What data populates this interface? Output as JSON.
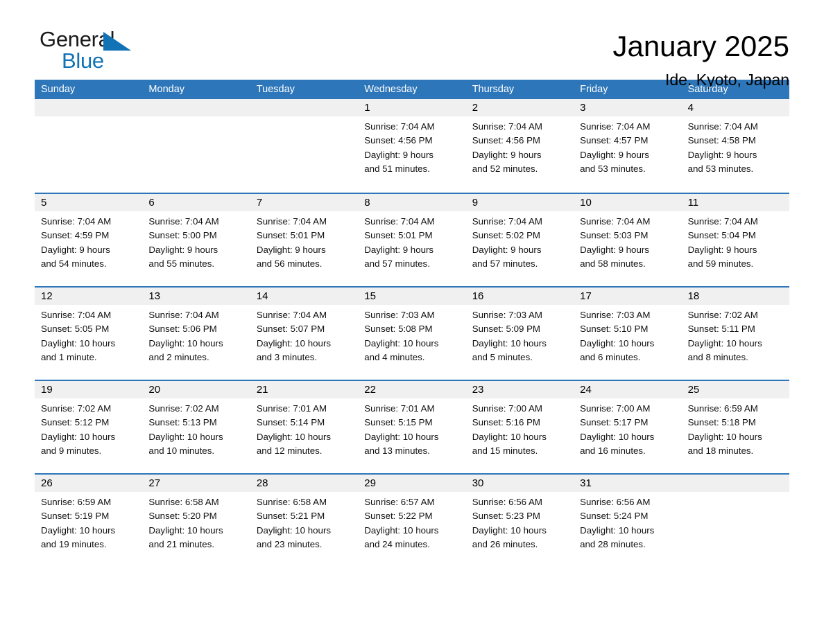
{
  "logo": {
    "line1": "General",
    "line2": "Blue",
    "triangle_color": "#1272b6"
  },
  "header": {
    "month_title": "January 2025",
    "location": "Ide, Kyoto, Japan",
    "header_bg_color": "#2d76b9",
    "row_rule_color": "#2d76b9",
    "day_number_bg": "#f0f0f0"
  },
  "weekdays": [
    "Sunday",
    "Monday",
    "Tuesday",
    "Wednesday",
    "Thursday",
    "Friday",
    "Saturday"
  ],
  "weeks": [
    [
      {
        "day": "",
        "sunrise": "",
        "sunset": "",
        "daylight1": "",
        "daylight2": ""
      },
      {
        "day": "",
        "sunrise": "",
        "sunset": "",
        "daylight1": "",
        "daylight2": ""
      },
      {
        "day": "",
        "sunrise": "",
        "sunset": "",
        "daylight1": "",
        "daylight2": ""
      },
      {
        "day": "1",
        "sunrise": "Sunrise: 7:04 AM",
        "sunset": "Sunset: 4:56 PM",
        "daylight1": "Daylight: 9 hours",
        "daylight2": "and 51 minutes."
      },
      {
        "day": "2",
        "sunrise": "Sunrise: 7:04 AM",
        "sunset": "Sunset: 4:56 PM",
        "daylight1": "Daylight: 9 hours",
        "daylight2": "and 52 minutes."
      },
      {
        "day": "3",
        "sunrise": "Sunrise: 7:04 AM",
        "sunset": "Sunset: 4:57 PM",
        "daylight1": "Daylight: 9 hours",
        "daylight2": "and 53 minutes."
      },
      {
        "day": "4",
        "sunrise": "Sunrise: 7:04 AM",
        "sunset": "Sunset: 4:58 PM",
        "daylight1": "Daylight: 9 hours",
        "daylight2": "and 53 minutes."
      }
    ],
    [
      {
        "day": "5",
        "sunrise": "Sunrise: 7:04 AM",
        "sunset": "Sunset: 4:59 PM",
        "daylight1": "Daylight: 9 hours",
        "daylight2": "and 54 minutes."
      },
      {
        "day": "6",
        "sunrise": "Sunrise: 7:04 AM",
        "sunset": "Sunset: 5:00 PM",
        "daylight1": "Daylight: 9 hours",
        "daylight2": "and 55 minutes."
      },
      {
        "day": "7",
        "sunrise": "Sunrise: 7:04 AM",
        "sunset": "Sunset: 5:01 PM",
        "daylight1": "Daylight: 9 hours",
        "daylight2": "and 56 minutes."
      },
      {
        "day": "8",
        "sunrise": "Sunrise: 7:04 AM",
        "sunset": "Sunset: 5:01 PM",
        "daylight1": "Daylight: 9 hours",
        "daylight2": "and 57 minutes."
      },
      {
        "day": "9",
        "sunrise": "Sunrise: 7:04 AM",
        "sunset": "Sunset: 5:02 PM",
        "daylight1": "Daylight: 9 hours",
        "daylight2": "and 57 minutes."
      },
      {
        "day": "10",
        "sunrise": "Sunrise: 7:04 AM",
        "sunset": "Sunset: 5:03 PM",
        "daylight1": "Daylight: 9 hours",
        "daylight2": "and 58 minutes."
      },
      {
        "day": "11",
        "sunrise": "Sunrise: 7:04 AM",
        "sunset": "Sunset: 5:04 PM",
        "daylight1": "Daylight: 9 hours",
        "daylight2": "and 59 minutes."
      }
    ],
    [
      {
        "day": "12",
        "sunrise": "Sunrise: 7:04 AM",
        "sunset": "Sunset: 5:05 PM",
        "daylight1": "Daylight: 10 hours",
        "daylight2": "and 1 minute."
      },
      {
        "day": "13",
        "sunrise": "Sunrise: 7:04 AM",
        "sunset": "Sunset: 5:06 PM",
        "daylight1": "Daylight: 10 hours",
        "daylight2": "and 2 minutes."
      },
      {
        "day": "14",
        "sunrise": "Sunrise: 7:04 AM",
        "sunset": "Sunset: 5:07 PM",
        "daylight1": "Daylight: 10 hours",
        "daylight2": "and 3 minutes."
      },
      {
        "day": "15",
        "sunrise": "Sunrise: 7:03 AM",
        "sunset": "Sunset: 5:08 PM",
        "daylight1": "Daylight: 10 hours",
        "daylight2": "and 4 minutes."
      },
      {
        "day": "16",
        "sunrise": "Sunrise: 7:03 AM",
        "sunset": "Sunset: 5:09 PM",
        "daylight1": "Daylight: 10 hours",
        "daylight2": "and 5 minutes."
      },
      {
        "day": "17",
        "sunrise": "Sunrise: 7:03 AM",
        "sunset": "Sunset: 5:10 PM",
        "daylight1": "Daylight: 10 hours",
        "daylight2": "and 6 minutes."
      },
      {
        "day": "18",
        "sunrise": "Sunrise: 7:02 AM",
        "sunset": "Sunset: 5:11 PM",
        "daylight1": "Daylight: 10 hours",
        "daylight2": "and 8 minutes."
      }
    ],
    [
      {
        "day": "19",
        "sunrise": "Sunrise: 7:02 AM",
        "sunset": "Sunset: 5:12 PM",
        "daylight1": "Daylight: 10 hours",
        "daylight2": "and 9 minutes."
      },
      {
        "day": "20",
        "sunrise": "Sunrise: 7:02 AM",
        "sunset": "Sunset: 5:13 PM",
        "daylight1": "Daylight: 10 hours",
        "daylight2": "and 10 minutes."
      },
      {
        "day": "21",
        "sunrise": "Sunrise: 7:01 AM",
        "sunset": "Sunset: 5:14 PM",
        "daylight1": "Daylight: 10 hours",
        "daylight2": "and 12 minutes."
      },
      {
        "day": "22",
        "sunrise": "Sunrise: 7:01 AM",
        "sunset": "Sunset: 5:15 PM",
        "daylight1": "Daylight: 10 hours",
        "daylight2": "and 13 minutes."
      },
      {
        "day": "23",
        "sunrise": "Sunrise: 7:00 AM",
        "sunset": "Sunset: 5:16 PM",
        "daylight1": "Daylight: 10 hours",
        "daylight2": "and 15 minutes."
      },
      {
        "day": "24",
        "sunrise": "Sunrise: 7:00 AM",
        "sunset": "Sunset: 5:17 PM",
        "daylight1": "Daylight: 10 hours",
        "daylight2": "and 16 minutes."
      },
      {
        "day": "25",
        "sunrise": "Sunrise: 6:59 AM",
        "sunset": "Sunset: 5:18 PM",
        "daylight1": "Daylight: 10 hours",
        "daylight2": "and 18 minutes."
      }
    ],
    [
      {
        "day": "26",
        "sunrise": "Sunrise: 6:59 AM",
        "sunset": "Sunset: 5:19 PM",
        "daylight1": "Daylight: 10 hours",
        "daylight2": "and 19 minutes."
      },
      {
        "day": "27",
        "sunrise": "Sunrise: 6:58 AM",
        "sunset": "Sunset: 5:20 PM",
        "daylight1": "Daylight: 10 hours",
        "daylight2": "and 21 minutes."
      },
      {
        "day": "28",
        "sunrise": "Sunrise: 6:58 AM",
        "sunset": "Sunset: 5:21 PM",
        "daylight1": "Daylight: 10 hours",
        "daylight2": "and 23 minutes."
      },
      {
        "day": "29",
        "sunrise": "Sunrise: 6:57 AM",
        "sunset": "Sunset: 5:22 PM",
        "daylight1": "Daylight: 10 hours",
        "daylight2": "and 24 minutes."
      },
      {
        "day": "30",
        "sunrise": "Sunrise: 6:56 AM",
        "sunset": "Sunset: 5:23 PM",
        "daylight1": "Daylight: 10 hours",
        "daylight2": "and 26 minutes."
      },
      {
        "day": "31",
        "sunrise": "Sunrise: 6:56 AM",
        "sunset": "Sunset: 5:24 PM",
        "daylight1": "Daylight: 10 hours",
        "daylight2": "and 28 minutes."
      },
      {
        "day": "",
        "sunrise": "",
        "sunset": "",
        "daylight1": "",
        "daylight2": ""
      }
    ]
  ]
}
